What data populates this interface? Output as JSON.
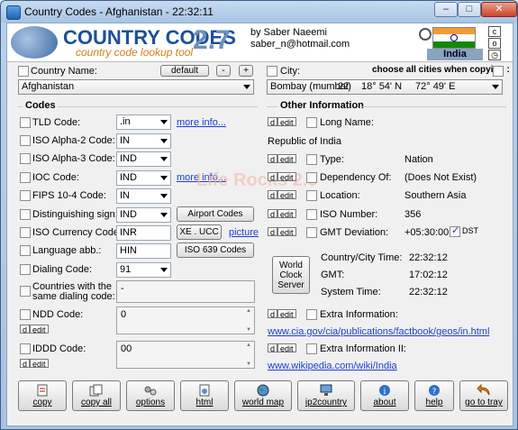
{
  "window": {
    "title": "Country Codes - Afghanistan - 22:32:11"
  },
  "banner": {
    "logo_title": "COUNTRY CODES",
    "logo_version": "2.7",
    "logo_subtitle": "country code lookup tool",
    "author_line1": "by Saber Naeemi",
    "author_line2": "saber_n@hotmail.com",
    "flag_label": "India",
    "btn_c": "c",
    "btn_o": "o",
    "flag_colors": {
      "saffron": "#f29a33",
      "white": "#ffffff",
      "green": "#138808"
    }
  },
  "country": {
    "label": "Country Name:",
    "default_btn": "default",
    "minus_btn": "-",
    "plus_btn": "+",
    "value": "Afghanistan"
  },
  "city": {
    "label": "City:",
    "choose_all_label": "choose all cities when copying :",
    "value_name": "Bombay (mumbai)",
    "value_num": "22",
    "value_lat": "18° 54' N",
    "value_lon": "72° 49' E"
  },
  "codes": {
    "title": "Codes",
    "tld": {
      "label": "TLD Code:",
      "value": ".in",
      "link": "more info..."
    },
    "alpha2": {
      "label": "ISO Alpha-2 Code:",
      "value": "IN"
    },
    "alpha3": {
      "label": "ISO Alpha-3 Code:",
      "value": "IND"
    },
    "ioc": {
      "label": "IOC Code:",
      "value": "IND",
      "link": "more info..."
    },
    "fips": {
      "label": "FIPS 10-4 Code:",
      "value": "IN"
    },
    "sign": {
      "label": "Distinguishing sign:",
      "value": "IND",
      "button": "Airport Codes"
    },
    "currency": {
      "label": "ISO Currency Code:",
      "value": "INR",
      "button": "XE . UCC",
      "link": "picture"
    },
    "language": {
      "label": "Language abb.:",
      "value": "HIN",
      "button": "ISO 639 Codes"
    },
    "dialing": {
      "label": "Dialing Code:",
      "value": "91"
    },
    "same_dialing": {
      "label1": "Countries with the",
      "label2": "same dialing code:",
      "value": "-"
    },
    "ndd": {
      "label": "NDD Code:",
      "value": "0"
    },
    "iddd": {
      "label": "IDDD Code:",
      "value": "00"
    }
  },
  "de": {
    "d": "d",
    "edit": "edit"
  },
  "other": {
    "title": "Other Information",
    "long_name": {
      "label": "Long Name:",
      "value": "Republic of India"
    },
    "type": {
      "label": "Type:",
      "value": "Nation"
    },
    "dependency": {
      "label": "Dependency Of:",
      "value": "(Does Not Exist)"
    },
    "location": {
      "label": "Location:",
      "value": "Southern Asia"
    },
    "iso_number": {
      "label": "ISO Number:",
      "value": "356"
    },
    "gmt": {
      "label": "GMT Deviation:",
      "value": "+05:30:00",
      "dst": "DST"
    },
    "world_clock": {
      "line1": "World",
      "line2": "Clock",
      "line3": "Server"
    },
    "time_rows": [
      {
        "label": "Country/City Time:",
        "value": "22:32:12"
      },
      {
        "label": "GMT:",
        "value": "17:02:12"
      },
      {
        "label": "System Time:",
        "value": "22:32:12"
      }
    ],
    "extra1": {
      "label": "Extra Information:",
      "link": "www.cia.gov/cia/publications/factbook/geos/in.html"
    },
    "extra2": {
      "label": "Extra Information II:",
      "link": "www.wikipedia.com/wiki/India"
    }
  },
  "watermark": "Life Rocks 2.0",
  "buttons": [
    "copy",
    "copy all",
    "options",
    "html",
    "world map",
    "ip2country",
    "about",
    "help",
    "go to tray"
  ]
}
